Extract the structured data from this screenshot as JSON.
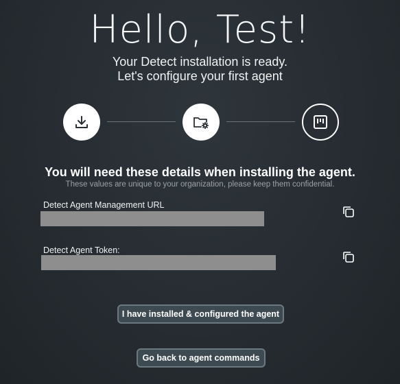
{
  "greeting": "Hello, Test!",
  "subtitle_line1": "Your Detect installation is ready.",
  "subtitle_line2": "Let's configure your first agent",
  "stepper": {
    "steps": [
      {
        "icon": "download-icon",
        "state": "done"
      },
      {
        "icon": "folder-settings-icon",
        "state": "done"
      },
      {
        "icon": "agent-board-icon",
        "state": "current"
      }
    ]
  },
  "details": {
    "title": "You will need these details when installing the agent.",
    "note": "These values are unique to your organization, please keep them confidential.",
    "url_label": "Detect Agent Management URL",
    "token_label": "Detect Agent Token:"
  },
  "buttons": {
    "installed": "I have installed & configured the agent",
    "back": "Go back to agent commands"
  },
  "colors": {
    "background": "#262c31",
    "button_bg": "#3e4a52",
    "button_border": "#6c7980",
    "redacted": "#8e8e8e"
  }
}
